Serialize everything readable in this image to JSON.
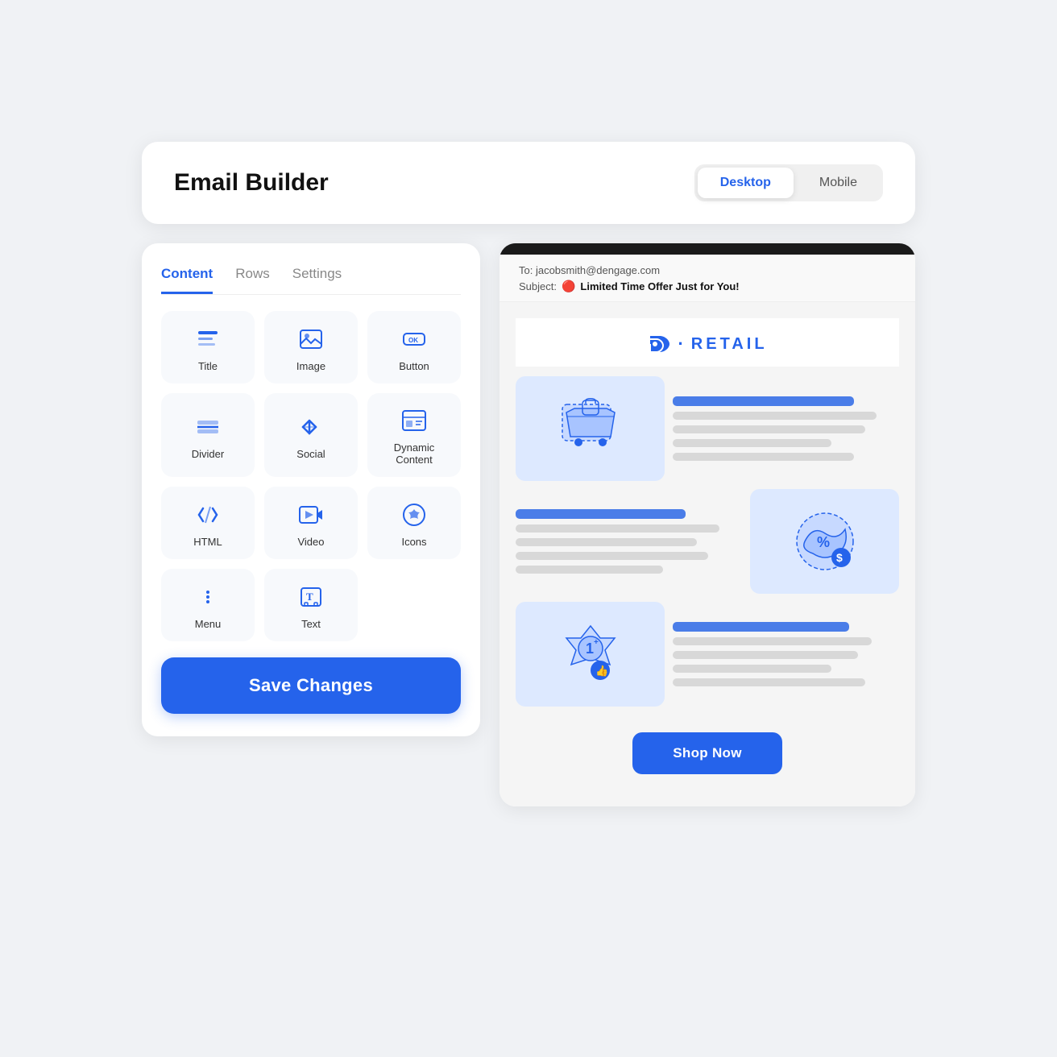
{
  "header": {
    "title": "Email Builder",
    "toggle": {
      "desktop_label": "Desktop",
      "mobile_label": "Mobile",
      "active": "desktop"
    }
  },
  "left_panel": {
    "tabs": [
      {
        "id": "content",
        "label": "Content",
        "active": true
      },
      {
        "id": "rows",
        "label": "Rows",
        "active": false
      },
      {
        "id": "settings",
        "label": "Settings",
        "active": false
      }
    ],
    "grid_items": [
      {
        "id": "title",
        "label": "Title",
        "icon": "title"
      },
      {
        "id": "image",
        "label": "Image",
        "icon": "image"
      },
      {
        "id": "button",
        "label": "Button",
        "icon": "button"
      },
      {
        "id": "divider",
        "label": "Divider",
        "icon": "divider"
      },
      {
        "id": "social",
        "label": "Social",
        "icon": "social"
      },
      {
        "id": "dynamic-content",
        "label": "Dynamic Content",
        "icon": "dynamic"
      },
      {
        "id": "html",
        "label": "HTML",
        "icon": "html"
      },
      {
        "id": "video",
        "label": "Video",
        "icon": "video"
      },
      {
        "id": "icons",
        "label": "Icons",
        "icon": "icons"
      },
      {
        "id": "menu",
        "label": "Menu",
        "icon": "menu"
      },
      {
        "id": "text",
        "label": "Text",
        "icon": "text"
      }
    ],
    "save_button": "Save Changes"
  },
  "email_preview": {
    "to": "To: jacobsmith@dengage.com",
    "subject_label": "Subject:",
    "subject_text": "Limited Time Offer Just for You!",
    "brand": "RETAIL",
    "brand_prefix": "D·",
    "shop_now": "Shop Now"
  }
}
